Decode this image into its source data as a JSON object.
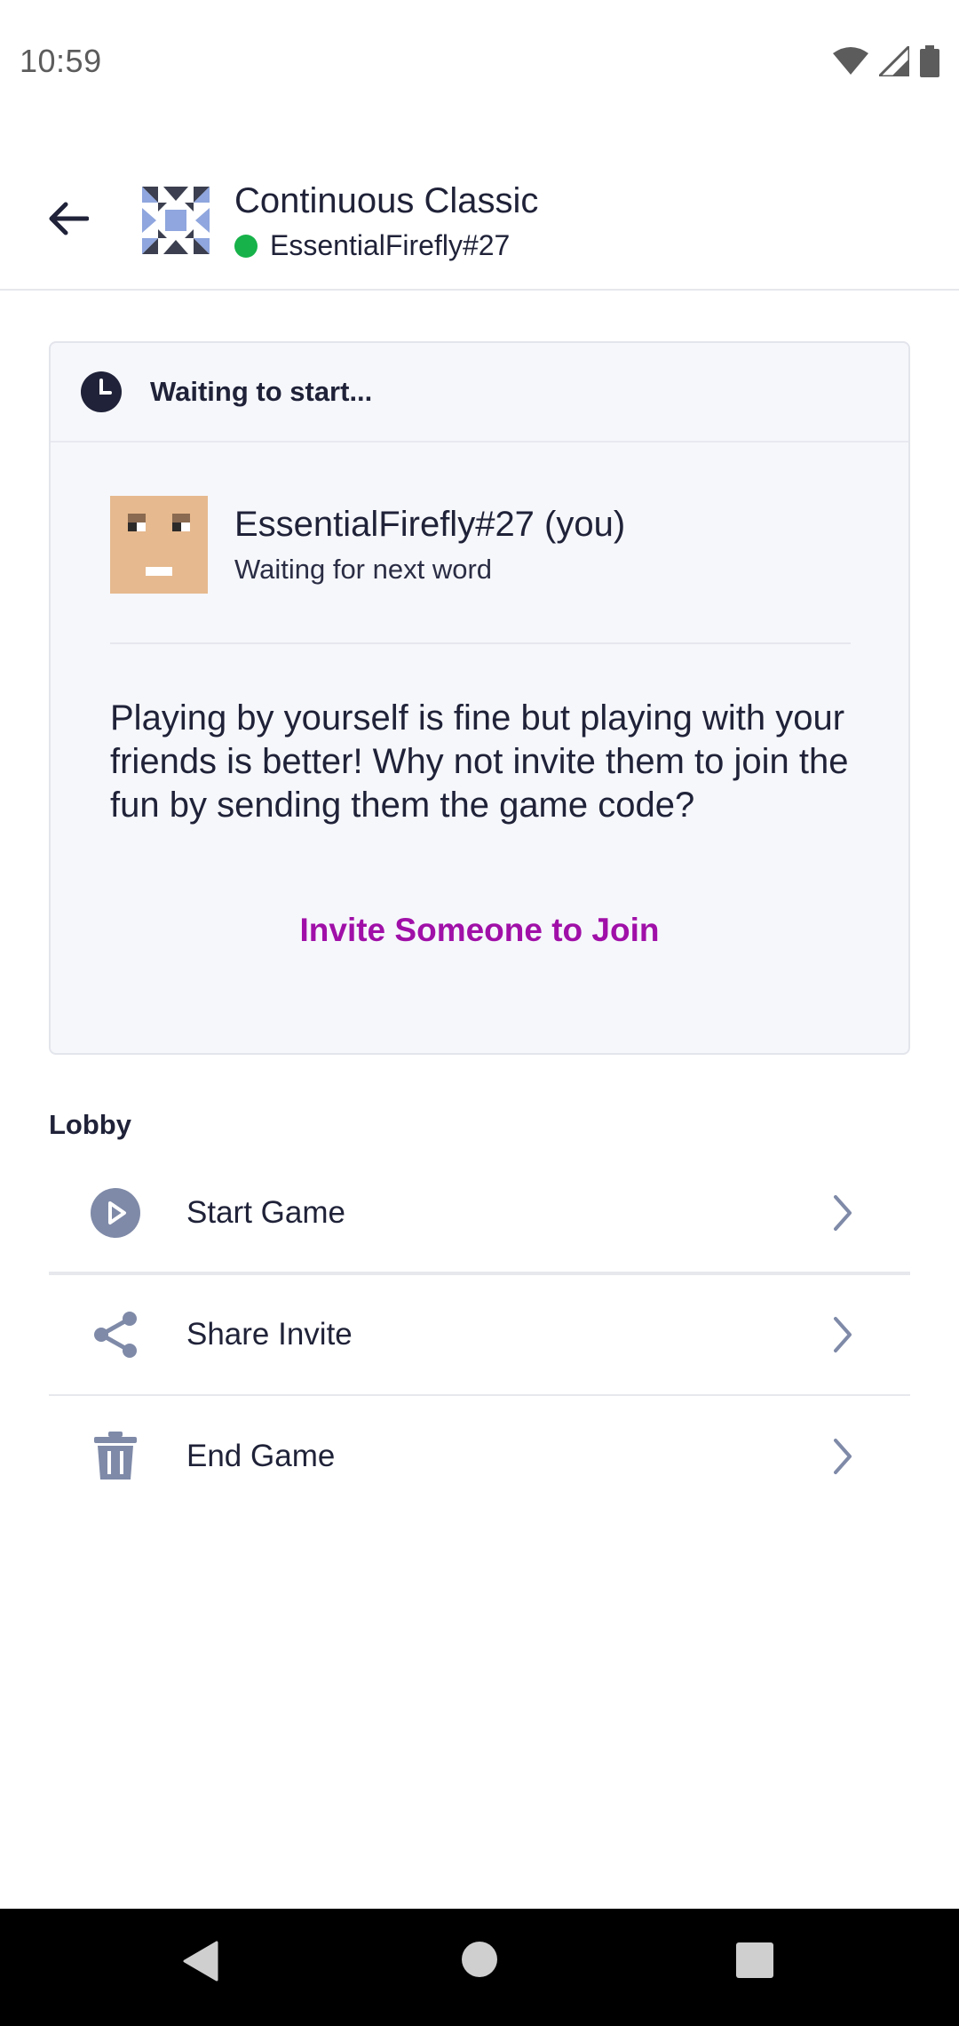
{
  "status_bar": {
    "time": "10:59",
    "icons": [
      "wifi-icon",
      "signal-icon",
      "battery-icon"
    ]
  },
  "header": {
    "title": "Continuous Classic",
    "username": "EssentialFirefly#27",
    "online_color": "#17b24a"
  },
  "card": {
    "status_text": "Waiting to start...",
    "player_name": "EssentialFirefly#27 (you)",
    "player_status": "Waiting for next word",
    "message": "Playing by yourself is fine but playing with your friends is better! Why not invite them to join the fun by sending them the game code?",
    "invite_label": "Invite Someone to Join",
    "invite_color": "#a010a8"
  },
  "lobby": {
    "label": "Lobby",
    "items": [
      {
        "label": "Start Game",
        "icon": "play-icon"
      },
      {
        "label": "Share Invite",
        "icon": "share-icon"
      },
      {
        "label": "End Game",
        "icon": "trash-icon"
      }
    ]
  },
  "nav": {
    "buttons": [
      "back-nav-icon",
      "home-nav-icon",
      "recents-nav-icon"
    ]
  }
}
